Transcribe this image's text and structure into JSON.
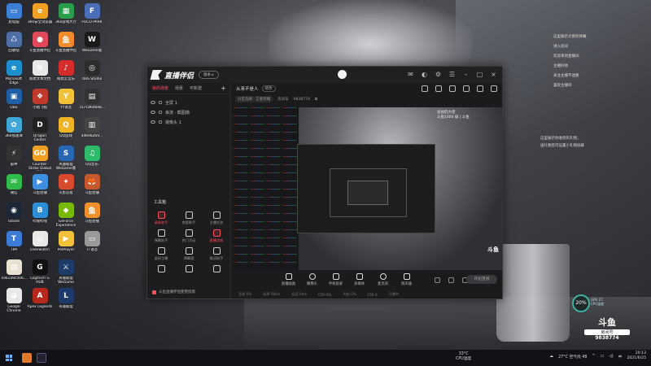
{
  "desktop_icons": [
    {
      "label": "此电脑",
      "color": "#3b7fd6",
      "glyph": "▭"
    },
    {
      "label": "360安全浏览器",
      "color": "#f0a023",
      "glyph": "e"
    },
    {
      "label": "360游戏大厅",
      "color": "#2a9d4b",
      "glyph": "▦"
    },
    {
      "label": "FOCO PARK",
      "color": "#4a6fb8",
      "glyph": "F"
    },
    {
      "label": "回收站",
      "color": "#4d6fa8",
      "glyph": "♺"
    },
    {
      "label": "斗鱼直播伴侣",
      "color": "#e0495a",
      "glyph": "●"
    },
    {
      "label": "斗鱼直播伴侣",
      "color": "#f28b2a",
      "glyph": "鱼"
    },
    {
      "label": "WeGame版",
      "color": "#1a1a1a",
      "glyph": "W"
    },
    {
      "label": "Microsoft Edge",
      "color": "#1e8fce",
      "glyph": "e"
    },
    {
      "label": "新建文本文档",
      "color": "#e8e8e8",
      "glyph": "≡"
    },
    {
      "label": "网易云音乐",
      "color": "#d62b2b",
      "glyph": "♪"
    },
    {
      "label": "OBS Studio",
      "color": "#2c2c2c",
      "glyph": "◎"
    },
    {
      "label": "OBS",
      "color": "#1f5fa8",
      "glyph": "▣"
    },
    {
      "label": "小猪飞视",
      "color": "#c0392b",
      "glyph": "❖"
    },
    {
      "label": "YY语音",
      "color": "#f2c13a",
      "glyph": "Y"
    },
    {
      "label": "ca7186d6e8...",
      "color": "#333",
      "glyph": "▤"
    },
    {
      "label": "360加速球",
      "color": "#3fa8d8",
      "glyph": "✿"
    },
    {
      "label": "Dragon Center",
      "color": "#222",
      "glyph": "D"
    },
    {
      "label": "QQ游戏",
      "color": "#f0b323",
      "glyph": "Q"
    },
    {
      "label": "a9b982b9...",
      "color": "#444",
      "glyph": "▥"
    },
    {
      "label": "雷神",
      "color": "#333",
      "glyph": "⚡"
    },
    {
      "label": "Counter-Strike Global Off.",
      "color": "#f0a023",
      "glyph": "GO"
    },
    {
      "label": "英雄联盟 WeGame版",
      "color": "#2766b3",
      "glyph": "S"
    },
    {
      "label": "QQ音乐",
      "color": "#2dbb6a",
      "glyph": "♫"
    },
    {
      "label": "微信",
      "color": "#2dbb4a",
      "glyph": "✉"
    },
    {
      "label": "斗鱼直播",
      "color": "#3e8fe0",
      "glyph": "▶"
    },
    {
      "label": "火影忍者",
      "color": "#d84a2b",
      "glyph": "✦"
    },
    {
      "label": "斗鱼直播",
      "color": "#c7572c",
      "glyph": "🦊"
    },
    {
      "label": "Steam",
      "color": "#1b2838",
      "glyph": "◉"
    },
    {
      "label": "哔哩哔哩",
      "color": "#2c8fd6",
      "glyph": "B"
    },
    {
      "label": "GeForce Experience",
      "color": "#76b900",
      "glyph": "◆"
    },
    {
      "label": "斗鱼直播",
      "color": "#f18f2a",
      "glyph": "鱼"
    },
    {
      "label": "TIM",
      "color": "#3c7bd6",
      "glyph": "T"
    },
    {
      "label": "Overwatch",
      "color": "#e8e8e8",
      "glyph": "◎"
    },
    {
      "label": "PotPlayer",
      "color": "#f2c13a",
      "glyph": "▶"
    },
    {
      "label": "TT语音",
      "color": "#999",
      "glyph": "▭"
    },
    {
      "label": "ea61a9c506...",
      "color": "#e8e0d0",
      "glyph": "▨"
    },
    {
      "label": "Logitech G HUB",
      "color": "#111",
      "glyph": "G"
    },
    {
      "label": "英雄联盟 WeGame",
      "color": "#1c3a6a",
      "glyph": "⚔"
    },
    {
      "label": "",
      "color": "transparent",
      "glyph": ""
    },
    {
      "label": "Google Chrome",
      "color": "#e8e8e8",
      "glyph": "◕"
    },
    {
      "label": "Apex Legends",
      "color": "#b7281d",
      "glyph": "A"
    },
    {
      "label": "英雄联盟",
      "color": "#1d3a6b",
      "glyph": "L"
    },
    {
      "label": "",
      "color": "transparent",
      "glyph": ""
    }
  ],
  "window": {
    "app_title": "直播伴侣",
    "version_pill": "版本 ▸",
    "tabs": [
      "我的场景",
      "场景",
      "可新建"
    ],
    "tab_add": "+",
    "scenes": [
      {
        "name": "全屏 1"
      },
      {
        "name": "串流 · 截图捕"
      },
      {
        "name": "摄像头 1"
      }
    ],
    "tools_title": "工具箱",
    "tools": [
      {
        "label": "录屏助手",
        "red": true
      },
      {
        "label": "房管助手",
        "red": false
      },
      {
        "label": "主播任务",
        "red": false
      },
      {
        "label": "弹幕助手",
        "red": false
      },
      {
        "label": "热门活动",
        "red": false
      },
      {
        "label": "直播游戏",
        "red": true
      },
      {
        "label": "虚拟主播",
        "red": false
      },
      {
        "label": "弹幕墙",
        "red": false
      },
      {
        "label": "歌词助手",
        "red": false
      },
      {
        "label": "",
        "red": false
      },
      {
        "label": "",
        "red": false
      },
      {
        "label": "",
        "red": false
      }
    ],
    "left_bottom_text": "斗鱼直播伴侣使用指南",
    "room_title": "从来不是人",
    "room_edit": "修改",
    "info": {
      "category": "分区选择 · 王者荣耀",
      "room_label": "房间号",
      "room_id": "9838774"
    },
    "preview_overlay": [
      "化妆的大佬",
      "斗鱼1000 级 | 斗鱼"
    ],
    "preview_logo": "斗鱼",
    "bottom_buttons": [
      "直播画面",
      "摄像头",
      "手机投屏",
      "多媒体",
      "麦克风",
      "扬声器"
    ],
    "live_button": "开始直播",
    "status": [
      "丢帧 0%",
      "码率 0kb/s",
      "延迟 0ms",
      "CPU 0%",
      "内存 0%",
      "FPS 0",
      "开播中"
    ]
  },
  "float_messages": [
    "这里展示大佬的弹幕",
    "进入房间",
    "欢迎来到直播间",
    "主播好帅",
    "关注主播不迷路",
    "喜欢主播吗"
  ],
  "float_messages2": [
    "这里展示你收到的礼物，",
    "送礼物后可设置小礼物屏蔽"
  ],
  "gauge": {
    "value": "20%",
    "label1": "GPU 27",
    "label2": "CPU温度"
  },
  "douyu_badge": {
    "logo": "斗鱼",
    "room_label": "房间号",
    "room_number": "9838774"
  },
  "taskbar": {
    "temp_value": "33°C",
    "temp_label": "CPU温度",
    "weather": "27°C 空气优 48",
    "time": "20:13",
    "date": "2021/6/25"
  }
}
